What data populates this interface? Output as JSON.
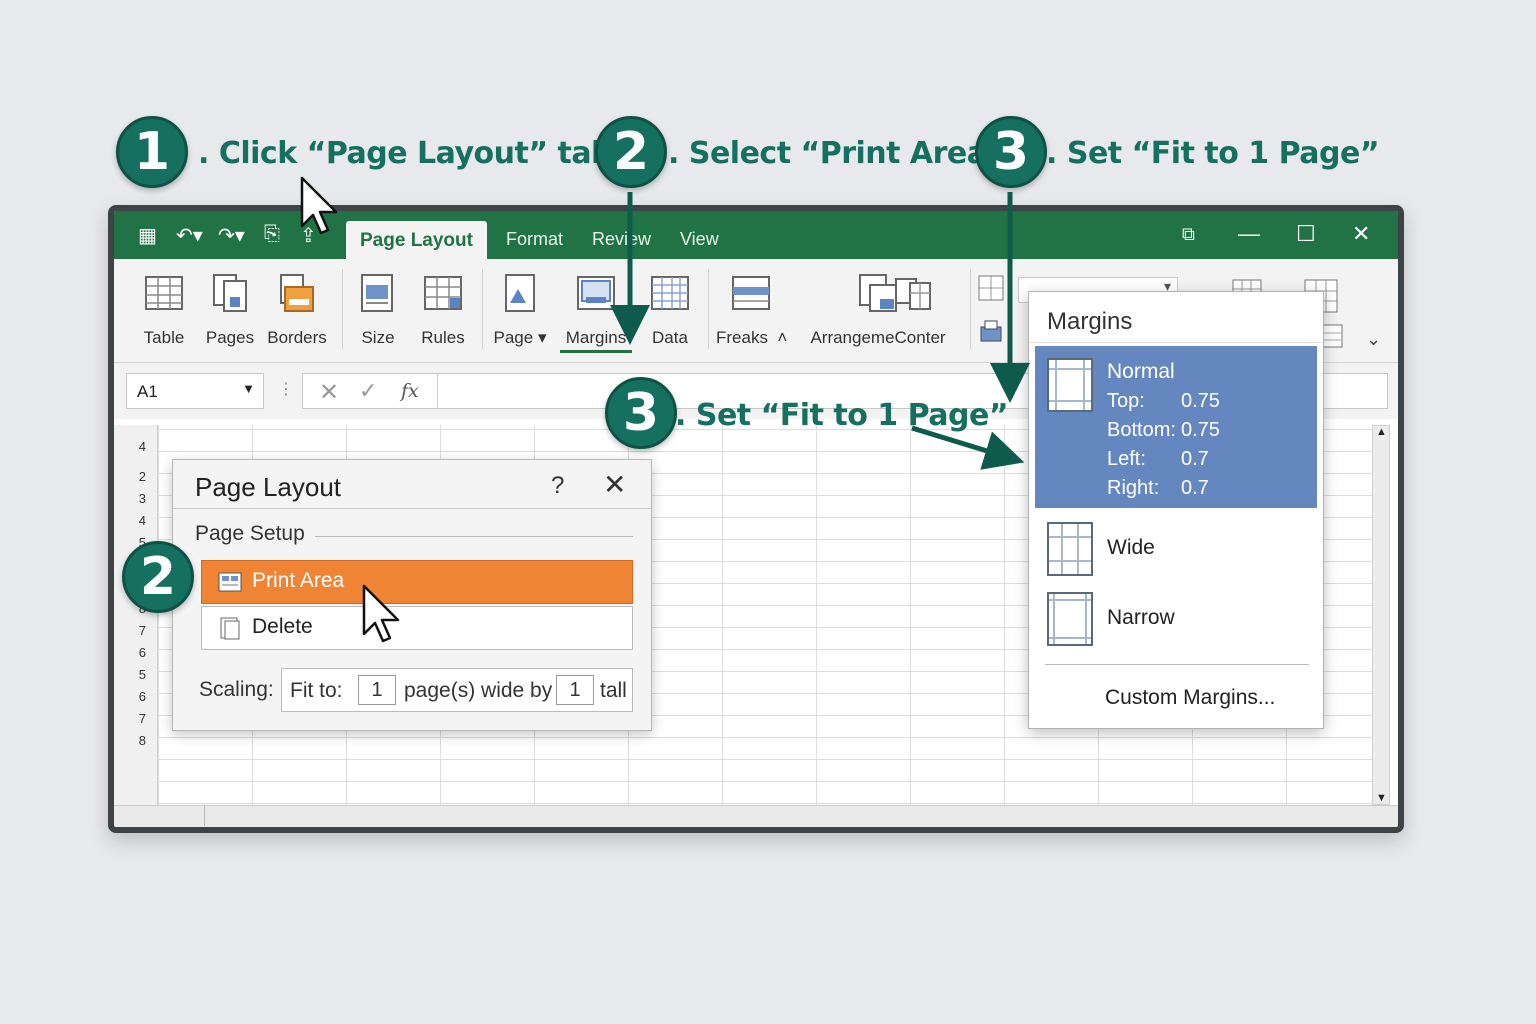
{
  "steps": [
    {
      "number": "1",
      "text": ". Click “Page Layout” tab"
    },
    {
      "number": "2",
      "text": ". Select “Print Area”"
    },
    {
      "number": "3",
      "text": ". Set “Fit to 1 Page”"
    },
    {
      "number": "3",
      "text": ". Set “Fit to 1 Page”"
    },
    {
      "number": "2",
      "text": ""
    }
  ],
  "tabs": {
    "page_layout": "Page Layout",
    "format": "Format",
    "review": "Review",
    "view": "View"
  },
  "ribbon": {
    "table": "Table",
    "pages": "Pages",
    "borders": "Borders",
    "size": "Size",
    "rules": "Rules",
    "page": "Page",
    "margins": "Margins",
    "data": "Data",
    "freaks": "Freaks",
    "arrange": "ArrangemeConter"
  },
  "formula_bar": {
    "name_box": "A1",
    "fx": "fx"
  },
  "row_numbers": [
    "4",
    "2",
    "3",
    "4",
    "5",
    "6",
    "7",
    "8",
    "7",
    "6",
    "5",
    "6",
    "7",
    "8"
  ],
  "dialog": {
    "title": "Page Layout",
    "help": "?",
    "group_label": "Page Setup",
    "print_area": "Print Area",
    "delete": "Delete",
    "scaling_label": "Scaling:",
    "fit_to": "Fit to:",
    "pages_wide": "1",
    "wide_by": "page(s) wide by",
    "pages_tall": "1",
    "tall": "tall"
  },
  "margins_menu": {
    "title": "Margins",
    "normal": {
      "name": "Normal",
      "top_label": "Top:",
      "top": "0.75",
      "bottom_label": "Bottom:",
      "bottom": "0.75",
      "left_label": "Left:",
      "left": "0.7",
      "right_label": "Right:",
      "right": "0.7"
    },
    "wide": "Wide",
    "narrow": "Narrow",
    "custom": "Custom Margins..."
  },
  "colors": {
    "excel_green": "#217346",
    "step_teal": "#16705f",
    "highlight_orange": "#ee8434",
    "selection_blue": "#6587bf"
  }
}
